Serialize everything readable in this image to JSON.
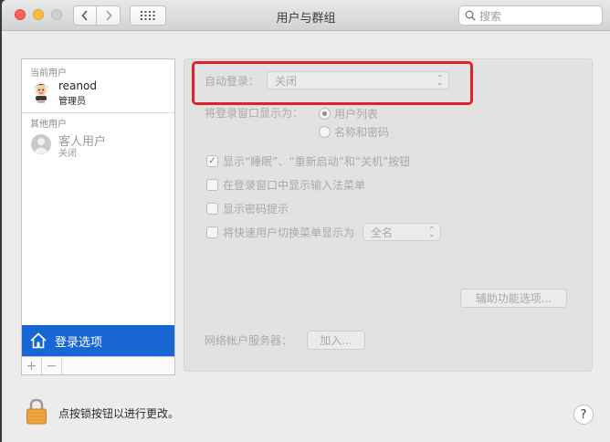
{
  "window": {
    "title": "用户与群组"
  },
  "search": {
    "placeholder": "搜索",
    "icon": "search-icon"
  },
  "toolbar": {
    "back_icon": "chevron-left-icon",
    "forward_icon": "chevron-right-icon",
    "grid_icon": "grid-icon"
  },
  "sidebar": {
    "current_users_label": "当前用户",
    "other_users_label": "其他用户",
    "users": [
      {
        "name": "reanod",
        "role": "管理员"
      },
      {
        "name": "客人用户",
        "role": "关闭"
      }
    ],
    "login_options_label": "登录选项",
    "add_label": "+",
    "remove_label": "−"
  },
  "panel": {
    "auto_login_label": "自动登录：",
    "auto_login_value": "关闭",
    "display_as_label": "将登录窗口显示为：",
    "display_options": [
      "用户列表",
      "名称和密码"
    ],
    "display_selected": "用户列表",
    "checkboxes": [
      {
        "label": "显示“睡眠”、“重新启动”和“关机”按钮",
        "checked": true
      },
      {
        "label": "在登录窗口中显示输入法菜单",
        "checked": false
      },
      {
        "label": "显示密码提示",
        "checked": false
      },
      {
        "label": "将快速用户切换菜单显示为",
        "checked": false
      }
    ],
    "fast_switch_value": "全名",
    "accessibility_button": "辅助功能选项...",
    "network_server_label": "网络帐户服务器：",
    "join_button": "加入..."
  },
  "footer": {
    "lock_text": "点按锁按钮以进行更改。",
    "help_label": "?"
  },
  "colors": {
    "accent": "#1766d4",
    "highlight": "#e0232a"
  }
}
